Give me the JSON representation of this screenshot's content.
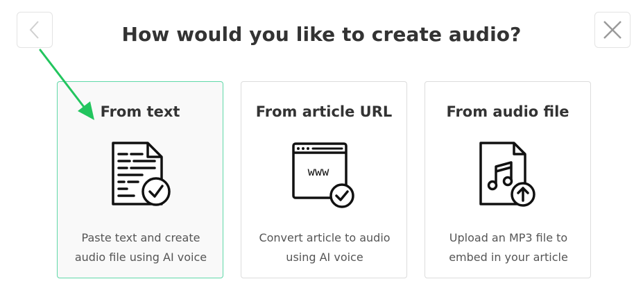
{
  "dialog": {
    "title": "How would you like to create audio?"
  },
  "options": [
    {
      "title": "From text",
      "description": "Paste text and create audio file using AI voice",
      "selected": true,
      "icon": "text-document-check-icon"
    },
    {
      "title": "From article URL",
      "description": "Convert article to audio using AI voice",
      "selected": false,
      "icon": "browser-www-check-icon"
    },
    {
      "title": "From audio file",
      "description": "Upload an MP3 file to embed in your article",
      "selected": false,
      "icon": "music-file-upload-icon"
    }
  ],
  "colors": {
    "selected_border": "#5fd8a8",
    "annotation_arrow": "#22c55e",
    "text": "#333333"
  }
}
